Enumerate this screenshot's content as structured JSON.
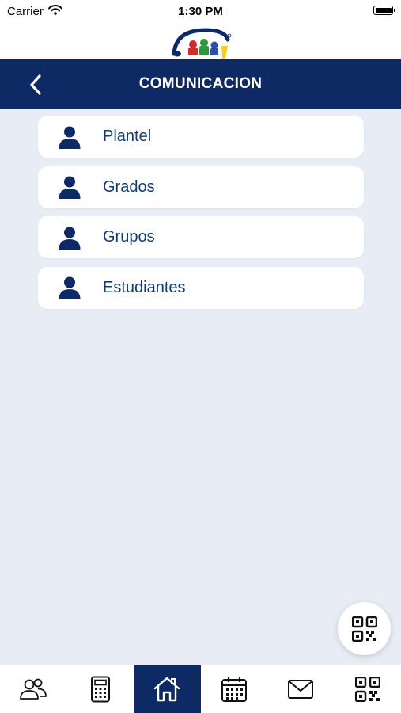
{
  "status_bar": {
    "carrier": "Carrier",
    "time": "1:30 PM"
  },
  "header": {
    "title": "COMUNICACION",
    "back_icon": "chevron-left-icon"
  },
  "menu": {
    "items": [
      {
        "label": "Plantel",
        "icon": "user-icon"
      },
      {
        "label": "Grados",
        "icon": "user-icon"
      },
      {
        "label": "Grupos",
        "icon": "user-icon"
      },
      {
        "label": "Estudiantes",
        "icon": "user-icon"
      }
    ]
  },
  "fab": {
    "icon": "qr-code-icon"
  },
  "tab_bar": {
    "active": "home",
    "tabs": [
      {
        "id": "people",
        "icon": "people-icon"
      },
      {
        "id": "calculator",
        "icon": "calculator-icon"
      },
      {
        "id": "home",
        "icon": "home-icon"
      },
      {
        "id": "calendar",
        "icon": "calendar-icon"
      },
      {
        "id": "mail",
        "icon": "mail-icon"
      },
      {
        "id": "qr",
        "icon": "qr-code-icon"
      }
    ]
  },
  "colors": {
    "primary": "#0e2a64",
    "text_blue": "#0e3b78",
    "background": "#e8ecf5",
    "card": "#ffffff"
  }
}
